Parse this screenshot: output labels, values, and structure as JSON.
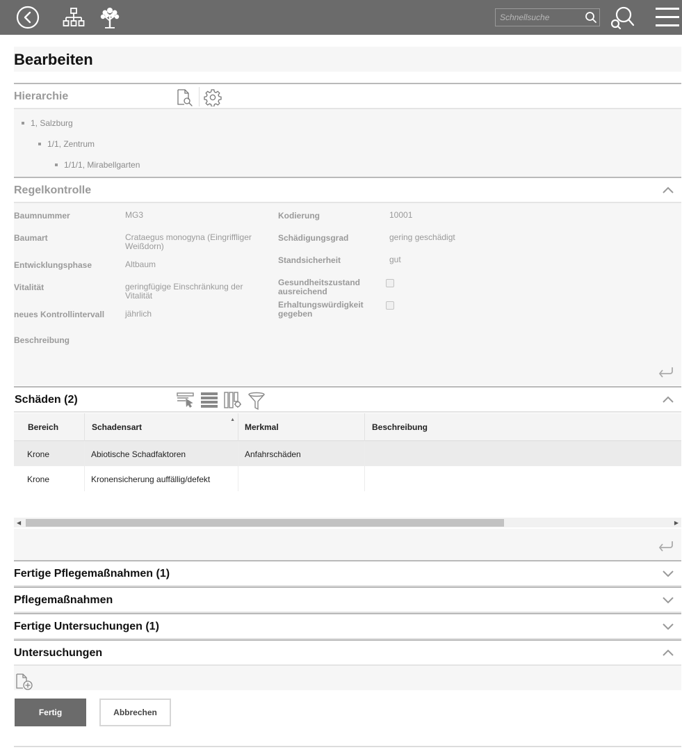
{
  "topbar": {
    "search_placeholder": "Schnellsuche",
    "icons": [
      "back-icon",
      "hierarchy-icon",
      "tree-icon",
      "search-icon",
      "advanced-search-icon",
      "menu-icon"
    ]
  },
  "page_title": "Bearbeiten",
  "hierarchie": {
    "title": "Hierarchie",
    "items": [
      "1, Salzburg",
      "1/1, Zentrum",
      "1/1/1, Mirabellgarten"
    ]
  },
  "regelkontrolle": {
    "title": "Regelkontrolle",
    "left": [
      {
        "label": "Baumnummer",
        "value": "MG3"
      },
      {
        "label": "Baumart",
        "value": "Crataegus monogyna (Eingriffliger Weißdorn)"
      },
      {
        "label": "Entwicklungsphase",
        "value": "Altbaum"
      },
      {
        "label": "Vitalität",
        "value": "geringfügige Einschränkung der Vitalität"
      },
      {
        "label": "neues Kontrollintervall",
        "value": "jährlich"
      },
      {
        "label": "Beschreibung",
        "value": ""
      }
    ],
    "right": [
      {
        "label": "Kodierung",
        "value": "10001"
      },
      {
        "label": "Schädigungsgrad",
        "value": "gering geschädigt"
      },
      {
        "label": "Standsicherheit",
        "value": "gut"
      },
      {
        "label": "Gesundheitszustand ausreichend",
        "checked": false
      },
      {
        "label": "Erhaltungswürdigkeit gegeben",
        "checked": false
      }
    ]
  },
  "schaeden": {
    "title": "Schäden (2)",
    "columns": [
      "Bereich",
      "Schadensart",
      "Merkmal",
      "Beschreibung"
    ],
    "rows": [
      [
        "Krone",
        "Abiotische Schadfaktoren",
        "Anfahrschäden",
        ""
      ],
      [
        "Krone",
        "Kronensicherung auffällig/defekt",
        "",
        ""
      ]
    ]
  },
  "collapsed_sections": {
    "fertige_pflege": "Fertige Pflegemaßnahmen (1)",
    "pflege": "Pflegemaßnahmen",
    "fertige_unters": "Fertige Untersuchungen (1)",
    "unters": "Untersuchungen"
  },
  "buttons": {
    "done": "Fertig",
    "cancel": "Abbrechen"
  },
  "colors": {
    "topbar": "#6b6b6b",
    "panel": "#f6f6f6",
    "primary_button": "#6b6b6b"
  }
}
